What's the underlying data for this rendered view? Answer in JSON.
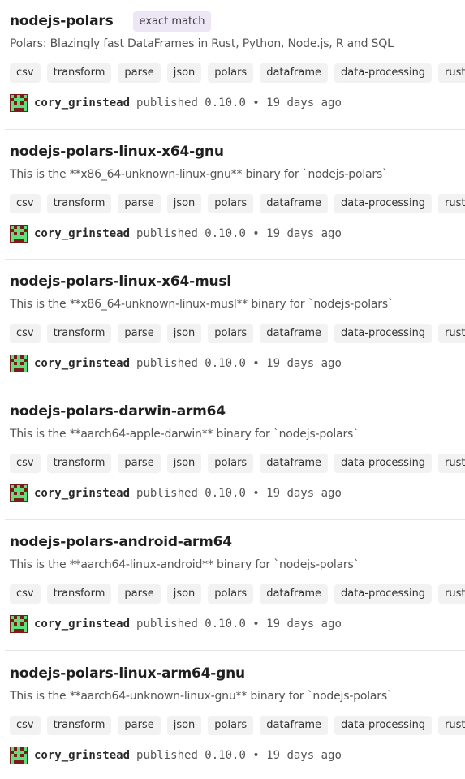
{
  "packages": [
    {
      "name": "nodejs-polars",
      "badge": "exact match",
      "description": "Polars: Blazingly fast DataFrames in Rust, Python, Node.js, R and SQL",
      "tags": [
        "csv",
        "transform",
        "parse",
        "json",
        "polars",
        "dataframe",
        "data-processing",
        "rust"
      ],
      "author": "cory_grinstead",
      "published": "published 0.10.0 • 19 days ago"
    },
    {
      "name": "nodejs-polars-linux-x64-gnu",
      "description": "This is the **x86_64-unknown-linux-gnu** binary for `nodejs-polars`",
      "tags": [
        "csv",
        "transform",
        "parse",
        "json",
        "polars",
        "dataframe",
        "data-processing",
        "rust"
      ],
      "author": "cory_grinstead",
      "published": "published 0.10.0 • 19 days ago"
    },
    {
      "name": "nodejs-polars-linux-x64-musl",
      "description": "This is the **x86_64-unknown-linux-musl** binary for `nodejs-polars`",
      "tags": [
        "csv",
        "transform",
        "parse",
        "json",
        "polars",
        "dataframe",
        "data-processing",
        "rust"
      ],
      "author": "cory_grinstead",
      "published": "published 0.10.0 • 19 days ago"
    },
    {
      "name": "nodejs-polars-darwin-arm64",
      "description": "This is the **aarch64-apple-darwin** binary for `nodejs-polars`",
      "tags": [
        "csv",
        "transform",
        "parse",
        "json",
        "polars",
        "dataframe",
        "data-processing",
        "rust"
      ],
      "author": "cory_grinstead",
      "published": "published 0.10.0 • 19 days ago"
    },
    {
      "name": "nodejs-polars-android-arm64",
      "description": "This is the **aarch64-linux-android** binary for `nodejs-polars`",
      "tags": [
        "csv",
        "transform",
        "parse",
        "json",
        "polars",
        "dataframe",
        "data-processing",
        "rust"
      ],
      "author": "cory_grinstead",
      "published": "published 0.10.0 • 19 days ago"
    },
    {
      "name": "nodejs-polars-linux-arm64-gnu",
      "description": "This is the **aarch64-unknown-linux-gnu** binary for `nodejs-polars`",
      "tags": [
        "csv",
        "transform",
        "parse",
        "json",
        "polars",
        "dataframe",
        "data-processing",
        "rust"
      ],
      "author": "cory_grinstead",
      "published": "published 0.10.0 • 19 days ago"
    }
  ],
  "colors": {
    "avatar_bg": "#7a1c1c",
    "avatar_fg": "#5ee07a",
    "badge_bg": "#ece6f5",
    "tag_bg": "#f2f2f2"
  },
  "icons": {
    "avatar": "identicon-avatar-icon"
  }
}
